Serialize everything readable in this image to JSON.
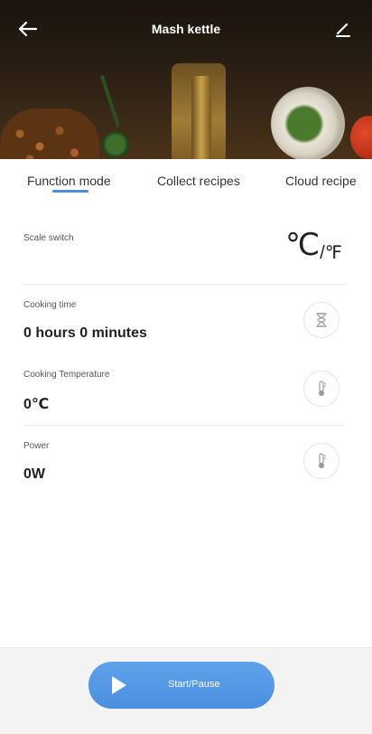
{
  "header": {
    "title": "Mash kettle",
    "back_icon": "arrow-left-icon",
    "edit_icon": "pencil-icon"
  },
  "tabs": [
    {
      "label": "Function mode",
      "active": true
    },
    {
      "label": "Collect recipes",
      "active": false
    },
    {
      "label": "Cloud recipe",
      "active": false
    }
  ],
  "scale": {
    "label": "Scale switch",
    "celsius": "℃",
    "fahrenheit": "/℉"
  },
  "cooking_time": {
    "label": "Cooking time",
    "value": "0 hours 0 minutes",
    "icon": "hourglass-icon"
  },
  "cooking_temperature": {
    "label": "Cooking Temperature",
    "value": "0℃",
    "icon": "thermometer-icon"
  },
  "power": {
    "label": "Power",
    "value": "0W",
    "icon": "thermometer-icon"
  },
  "action": {
    "label": "Start/Pause",
    "icon": "play-icon"
  },
  "colors": {
    "accent": "#4a8fe0",
    "bottom_bar": "#f3f3f3"
  }
}
